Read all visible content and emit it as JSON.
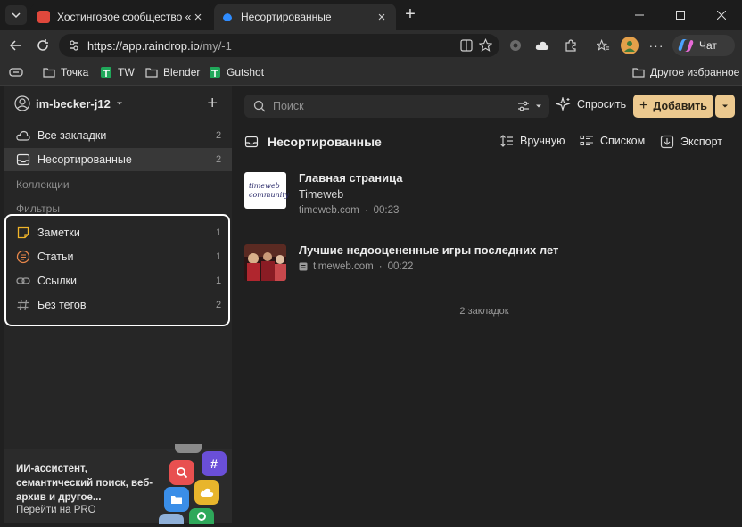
{
  "browser": {
    "tabs": [
      {
        "title": "Хостинговое сообщество «Timew",
        "favicon_color": "#e0483c"
      },
      {
        "title": "Несортированные",
        "favicon_color": "#2f8cff"
      }
    ],
    "url_host": "https://app.raindrop.io",
    "url_path": "/my/-1",
    "copilot_label": "Чат",
    "bookmarks": [
      {
        "label": "Точка"
      },
      {
        "label": "TW"
      },
      {
        "label": "Blender"
      },
      {
        "label": "Gutshot"
      }
    ],
    "other_bookmarks": "Другое избранное"
  },
  "sidebar": {
    "user": "im-becker-j12",
    "items": [
      {
        "label": "Все закладки",
        "count": "2"
      },
      {
        "label": "Несортированные",
        "count": "2"
      }
    ],
    "collections_label": "Коллекции",
    "filters_label": "Фильтры",
    "filters": [
      {
        "label": "Заметки",
        "count": "1"
      },
      {
        "label": "Статьи",
        "count": "1"
      },
      {
        "label": "Ссылки",
        "count": "1"
      },
      {
        "label": "Без тегов",
        "count": "2"
      }
    ],
    "promo_text": "ИИ-ассистент, семантический поиск, веб-архив и другое...",
    "promo_link": "Перейти на PRO"
  },
  "main": {
    "search_placeholder": "Поиск",
    "ask_label": "Спросить",
    "add_label": "Добавить",
    "title": "Несортированные",
    "sort_label": "Вручную",
    "view_label": "Списком",
    "export_label": "Экспорт",
    "bookmarks": [
      {
        "title": "Главная страница",
        "subtitle": "Timeweb",
        "domain": "timeweb.com",
        "time": "00:23",
        "thumb_text": "timeweb community"
      },
      {
        "title": "Лучшие недооцененные игры последних лет",
        "subtitle": "",
        "domain": "timeweb.com",
        "time": "00:22"
      }
    ],
    "count_label": "2 закладок"
  }
}
